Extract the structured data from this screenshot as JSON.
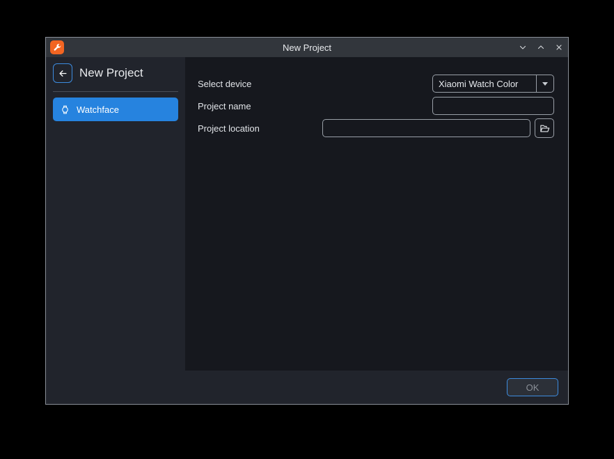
{
  "window": {
    "title": "New Project",
    "app_icon": "wrench-icon",
    "controls": [
      {
        "name": "minimize-button",
        "icon": "chevron-down-icon"
      },
      {
        "name": "maximize-button",
        "icon": "chevron-up-icon"
      },
      {
        "name": "close-button",
        "icon": "close-icon"
      }
    ]
  },
  "sidebar": {
    "back_icon": "arrow-left-icon",
    "title": "New Project",
    "items": [
      {
        "label": "Watchface",
        "icon": "watch-icon",
        "active": true
      }
    ]
  },
  "form": {
    "rows": [
      {
        "label": "Select device",
        "control": "combobox",
        "value": "Xiaomi Watch Color"
      },
      {
        "label": "Project name",
        "control": "text",
        "value": "",
        "placeholder": ""
      },
      {
        "label": "Project location",
        "control": "text-with-browse",
        "value": "",
        "placeholder": ""
      }
    ],
    "device_label": "Select device",
    "device_value": "Xiaomi Watch Color",
    "name_label": "Project name",
    "name_value": "",
    "name_placeholder": "",
    "location_label": "Project location",
    "location_value": "",
    "location_placeholder": "",
    "browse_icon": "folder-open-icon"
  },
  "footer": {
    "ok_label": "OK"
  },
  "colors": {
    "accent_blue": "#2683df",
    "focus_blue": "#3d8ce0",
    "app_orange": "#f26522",
    "titlebar": "#32363c",
    "sidebar": "#21242c",
    "content": "#16181e"
  }
}
